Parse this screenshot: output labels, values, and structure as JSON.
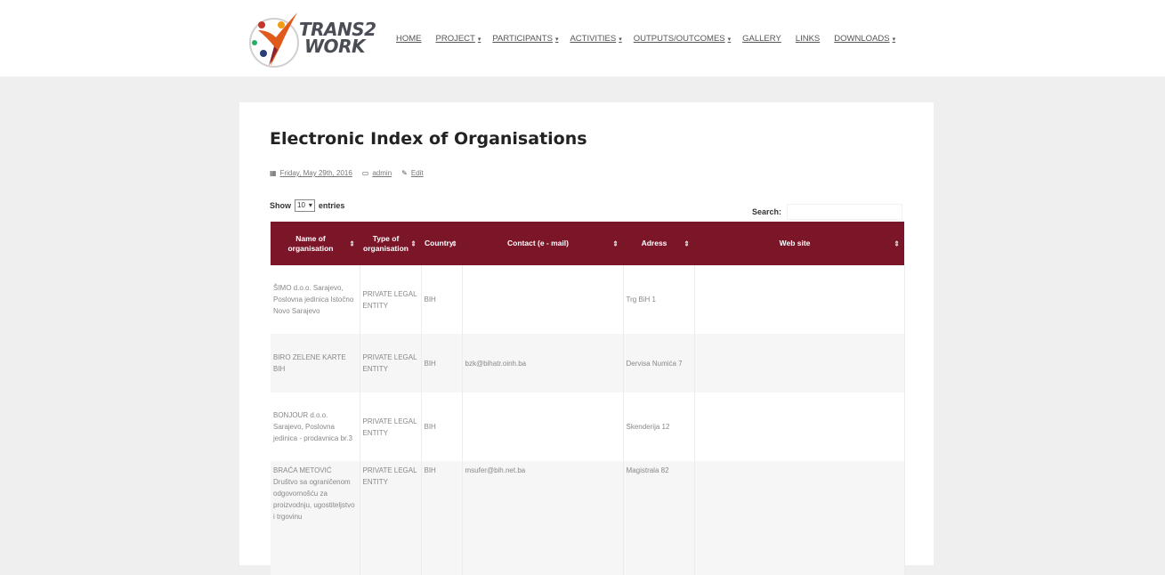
{
  "logo": {
    "line1": "TRANS2",
    "line2": "WORK"
  },
  "nav": [
    {
      "label": "HOME",
      "caret": ""
    },
    {
      "label": "PROJECT",
      "caret": "▾"
    },
    {
      "label": "PARTICIPANTS",
      "caret": "▾"
    },
    {
      "label": "ACTIVITIES",
      "caret": "▾"
    },
    {
      "label": "OUTPUTS/OUTCOMES",
      "caret": "▾"
    },
    {
      "label": "GALLERY",
      "caret": ""
    },
    {
      "label": "LINKS",
      "caret": ""
    },
    {
      "label": "DOWNLOADS",
      "caret": "▾"
    }
  ],
  "page": {
    "title": "Electronic Index of Organisations",
    "meta": {
      "date": "Friday, May 29th, 2016",
      "author": "admin",
      "edit": "Edit"
    }
  },
  "table_controls": {
    "show_label": "Show",
    "entries_value": "10",
    "entries_label": "entries",
    "search_label": "Search:",
    "search_value": ""
  },
  "table": {
    "headers": [
      {
        "label": "Name of organisation"
      },
      {
        "label": "Type of organisation"
      },
      {
        "label": "Country"
      },
      {
        "label": "Contact (e - mail)"
      },
      {
        "label": "Adress"
      },
      {
        "label": "Web site"
      }
    ],
    "rows": [
      {
        "name": "ŠIMO d.o.o. Sarajevo, Poslovna jedinica Istočno Novo Sarajevo",
        "type": "PRIVATE LEGAL ENTITY",
        "country": "BIH",
        "contact": "",
        "address": "Trg BiH 1",
        "web": ""
      },
      {
        "name": "BIRO ZELENE KARTE BIH",
        "type": "PRIVATE LEGAL ENTITY",
        "country": "BIH",
        "contact": "bzk@bihatr.oinh.ba",
        "address": "Dervisa Numića 7",
        "web": ""
      },
      {
        "name": "BONJOUR d.o.o. Sarajevo, Poslovna jedinica - prodavnica br.3",
        "type": "PRIVATE LEGAL ENTITY",
        "country": "BIH",
        "contact": "",
        "address": "Skenderija 12",
        "web": ""
      },
      {
        "name": "BRAĆA METOVIĆ Društvo sa ograničenom odgovornošću za proizvodnju, ugostiteljstvo i trgovinu",
        "type": "PRIVATE LEGAL ENTITY",
        "country": "BIH",
        "contact": "msufer@bih.net.ba",
        "address": "Magistrala 82",
        "web": ""
      }
    ]
  },
  "colors": {
    "header_bg": "#7b1528",
    "page_bg": "#efefef"
  }
}
